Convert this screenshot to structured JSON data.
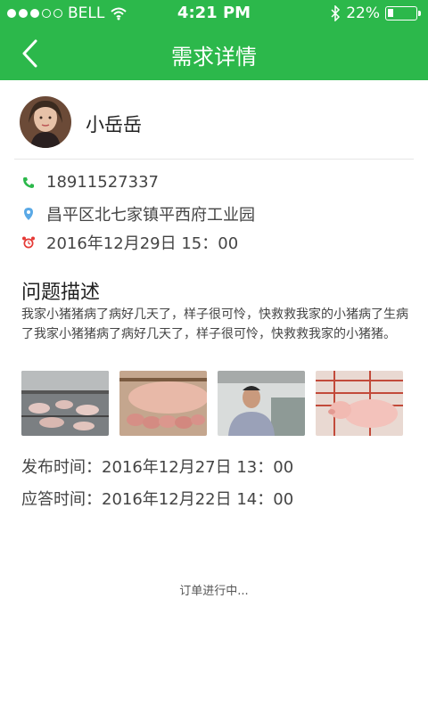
{
  "status_bar": {
    "carrier": "BELL",
    "time": "4:21 PM",
    "battery": "22%",
    "battery_level": 0.22,
    "icons": [
      "signal-dots",
      "wifi-icon",
      "bluetooth-icon",
      "battery-icon"
    ]
  },
  "nav": {
    "title": "需求详情",
    "back_icon": "chevron-left-icon"
  },
  "profile": {
    "name": "小岳岳",
    "avatar": "avatar"
  },
  "info": {
    "phone": "18911527337",
    "address": "昌平区北七家镇平西府工业园",
    "appointment": "2016年12月29日 15：00"
  },
  "problem": {
    "title": "问题描述",
    "description": "我家小猪猪病了病好几天了，样子很可怜，快救救我家的小猪病了生病了我家小猪猪病了病好几天了，样子很可怜，快救救我家的小猪猪。"
  },
  "thumbnails": [
    {
      "name": "photo-pig-farm"
    },
    {
      "name": "photo-piglets-nursing"
    },
    {
      "name": "photo-farmer"
    },
    {
      "name": "photo-pink-pig"
    }
  ],
  "meta": {
    "publish": "发布时间：2016年12月27日 13：00",
    "answer": "应答时间：2016年12月22日 14：00"
  },
  "order_status": "订单进行中...",
  "colors": {
    "brand_green": "#2cb84b",
    "phone_icon": "#2cb84b",
    "location_icon": "#5aa9e6",
    "alarm_icon": "#e53935"
  }
}
